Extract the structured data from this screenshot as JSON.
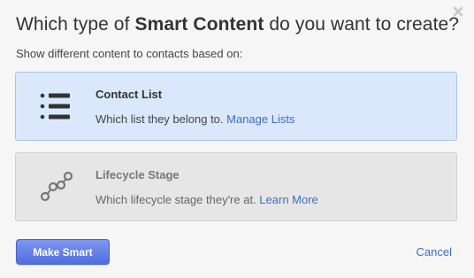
{
  "dialog": {
    "title_prefix": "Which type of ",
    "title_bold": "Smart Content",
    "title_suffix": " do you want to create?",
    "subtitle": "Show different content to contacts based on:",
    "close_icon": "close-icon"
  },
  "options": [
    {
      "title": "Contact List",
      "desc": "Which list they belong to. ",
      "link": "Manage Lists",
      "icon": "list-icon",
      "selected": true
    },
    {
      "title": "Lifecycle Stage",
      "desc": "Which lifecycle stage they're at. ",
      "link": "Learn More",
      "icon": "lifecycle-stage-icon",
      "selected": false
    }
  ],
  "footer": {
    "primary_label": "Make Smart",
    "cancel_label": "Cancel"
  },
  "colors": {
    "selected_bg": "#dbe8fb",
    "link": "#3d6fc2",
    "primary_button": "#5f7fe8"
  }
}
